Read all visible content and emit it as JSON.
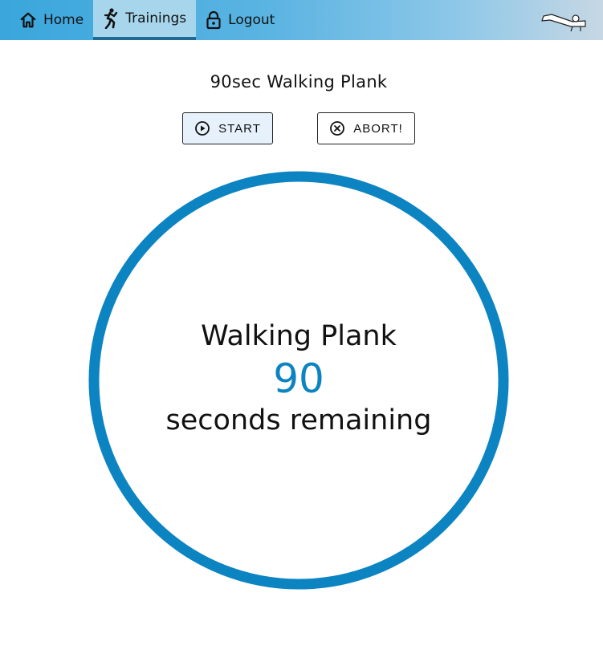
{
  "colors": {
    "accent": "#0c84c1",
    "nav_active_underline": "#1f6a95",
    "nav_active_bg": "#a7d6ec"
  },
  "nav": {
    "items": [
      {
        "label": "Home",
        "icon": "home-icon"
      },
      {
        "label": "Trainings",
        "icon": "runner-icon",
        "active": true
      },
      {
        "label": "Logout",
        "icon": "lock-icon"
      }
    ],
    "logo": "plank-logo"
  },
  "workout": {
    "title": "90sec Walking Plank"
  },
  "controls": {
    "start_label": "START",
    "start_icon": "play-circle-icon",
    "abort_label": "ABORT!",
    "abort_icon": "x-circle-icon"
  },
  "timer": {
    "exercise": "Walking Plank",
    "count": "90",
    "remaining_label": "seconds remaining",
    "progress": 1.0
  }
}
